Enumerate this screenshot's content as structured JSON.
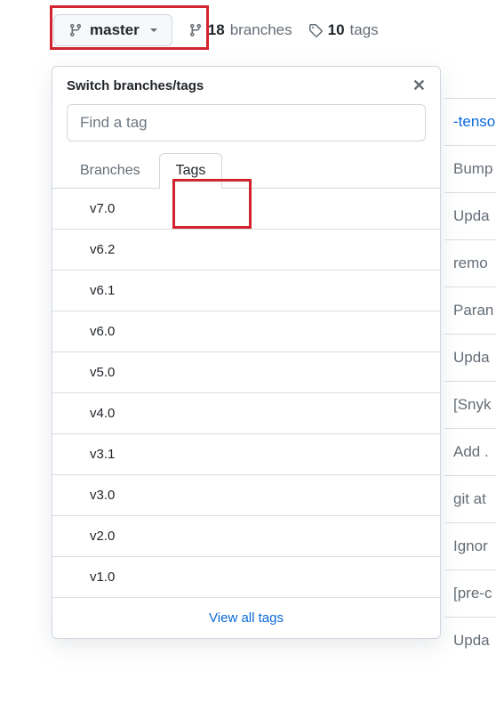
{
  "branchButton": {
    "label": "master"
  },
  "stats": {
    "branches": {
      "count": "18",
      "label": "branches"
    },
    "tags": {
      "count": "10",
      "label": "tags"
    }
  },
  "popover": {
    "title": "Switch branches/tags",
    "filterPlaceholder": "Find a tag",
    "tabs": {
      "branches": "Branches",
      "tags": "Tags"
    },
    "tagList": [
      "v7.0",
      "v6.2",
      "v6.1",
      "v6.0",
      "v5.0",
      "v4.0",
      "v3.1",
      "v3.0",
      "v2.0",
      "v1.0"
    ],
    "viewAll": "View all tags"
  },
  "backgroundRows": [
    "-tenso",
    "Bump",
    "Upda",
    "remo",
    "Paran",
    "Upda",
    "[Snyk",
    "Add .",
    "git at",
    "Ignor",
    "[pre-c",
    "Upda"
  ]
}
